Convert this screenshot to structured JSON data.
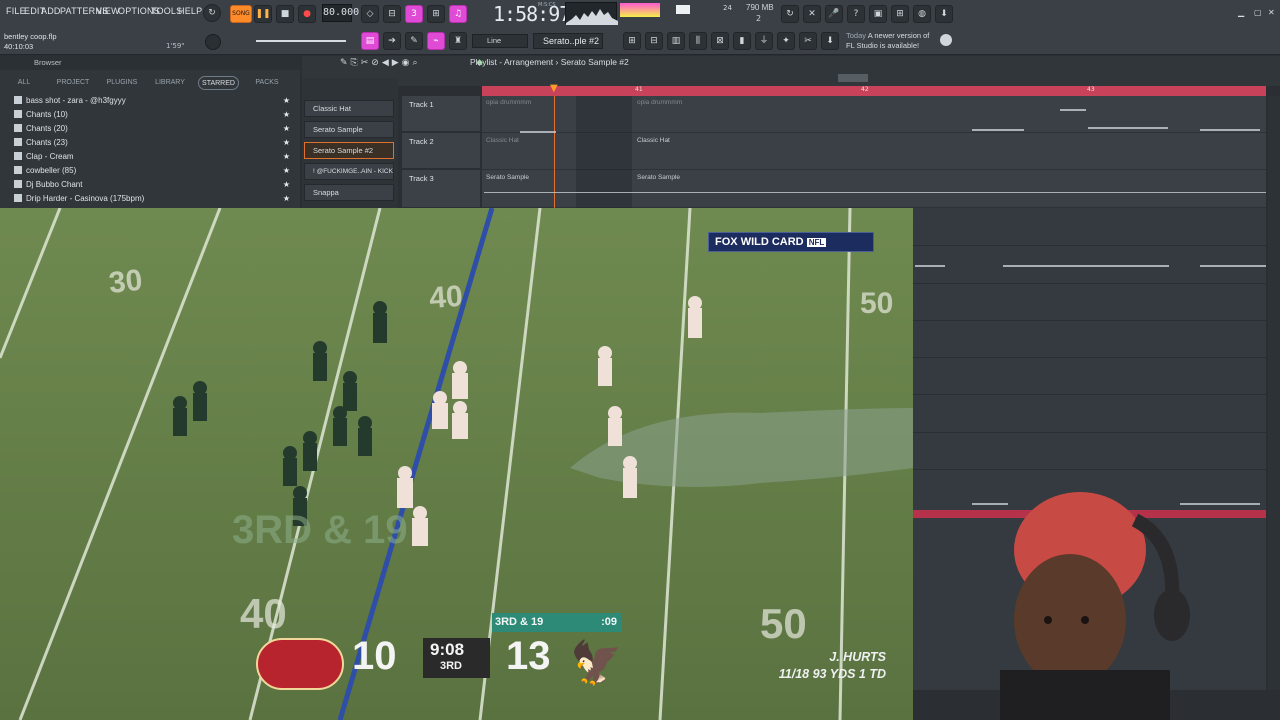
{
  "menu": [
    "FILE",
    "EDIT",
    "ADD",
    "PATTERNS",
    "VIEW",
    "OPTIONS",
    "TOOLS",
    "HELP"
  ],
  "transport": {
    "song_label": "SONG",
    "bpm": "80.000",
    "time": "1:58:97",
    "time_unit": "M:S:CS",
    "ram": "790 MB",
    "cpu": "2",
    "count_top": "24"
  },
  "project": {
    "name": "bentley coop.flp",
    "time": "40:10:03",
    "position": "1'59\""
  },
  "toolbar": {
    "snap": "Line",
    "pattern": "Serato..ple #2"
  },
  "hint": {
    "title": "Today",
    "text": "A newer version of FL Studio is available!"
  },
  "browser": {
    "title": "Browser",
    "tabs": [
      "ALL",
      "PROJECT",
      "PLUGINS",
      "LIBRARY",
      "STARRED",
      "PACKS"
    ],
    "active_tab": "STARRED",
    "items": [
      "bass shot - zara - @h3fgyyy",
      "Chants (10)",
      "Chants (20)",
      "Chants (23)",
      "Clap - Cream",
      "cowbeller (85)",
      "Dj Bubbo Chant",
      "Drip Harder - Casinova (175bpm)"
    ]
  },
  "channels": [
    "Classic Hat",
    "Serato Sample",
    "Serato Sample #2",
    "! @FUCKIMGE..AIN - KICK",
    "Snappa"
  ],
  "selected_channel": "Serato Sample #2",
  "playlist": {
    "title": "Playlist - Arrangement",
    "pattern": "Serato Sample #2",
    "ruler": [
      "41",
      "42",
      "43"
    ],
    "tracks": [
      {
        "name": "Track 1",
        "clips": [
          "opia drummmm",
          "opia drummmm"
        ]
      },
      {
        "name": "Track 2",
        "clips": [
          "Classic Hat",
          "Classic Hat"
        ]
      },
      {
        "name": "Track 3",
        "clips": [
          "Serato Sample",
          "Serato Sample"
        ]
      }
    ]
  },
  "video": {
    "network": "FOX",
    "event": "WILD CARD",
    "league": "NFL",
    "down_distance": "3RD & 19",
    "play_clock": ":09",
    "home_score": "10",
    "clock": "9:08",
    "quarter": "3RD",
    "away_score": "13",
    "field_text": "3RD & 19",
    "yard_numbers": [
      "30",
      "40",
      "50",
      "40",
      "50"
    ],
    "player_name": "J. HURTS",
    "player_stat": "11/18 93 YDS 1 TD"
  }
}
